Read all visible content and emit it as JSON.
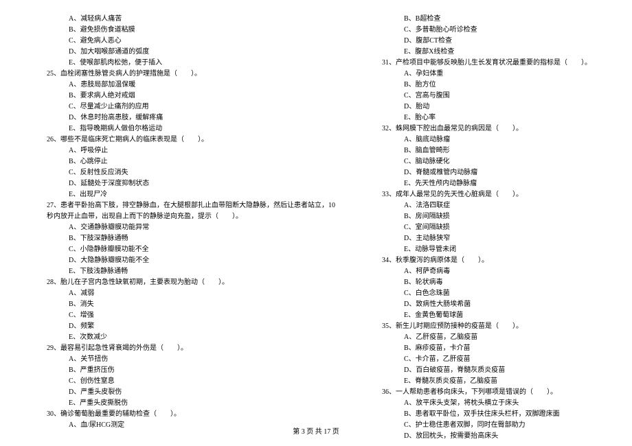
{
  "left_column": {
    "pre_options": [
      "A、减轻病人痛苦",
      "B、避免损伤食道粘膜",
      "C、避免病人恶心",
      "D、加大咽喉部通道的弧度",
      "E、使喉部肌肉松弛，便于插入"
    ],
    "q25": {
      "text": "25、血栓闭塞性脉管炎病人的护理措施是（　　）。",
      "options": [
        "A、患肢局部加温保暖",
        "B、要求病人绝对戒烟",
        "C、尽量减少止痛剂的应用",
        "D、休息时抬高患肢，缓解疼痛",
        "E、指导晚期病人做伯尔格运动"
      ]
    },
    "q26": {
      "text": "26、哪些不是临床死亡期病人的临床表现是（　　）。",
      "options": [
        "A、呼吸停止",
        "B、心跳停止",
        "C、反射性反应消失",
        "D、延髓处于深度抑制状态",
        "E、出现尸冷"
      ]
    },
    "q27": {
      "text": "27、患者平卧抬高下肢，排空静脉血，在大腿根部扎止血带阻断大隐静脉，然后让患者站立，10",
      "continuation": "秒内放开止血带，出现自上而下的静脉逆向充盈，提示（　　）。",
      "options": [
        "A、交通静脉瓣膜功能异常",
        "B、下肢深静脉通畅",
        "C、小隐静脉瓣膜功能不全",
        "D、大隐静脉瓣膜功能不全",
        "E、下肢浅静脉通畅"
      ]
    },
    "q28": {
      "text": "28、胎儿在子宫内急性缺氧初期，主要表现为胎动（　　）。",
      "options": [
        "A、减弱",
        "B、消失",
        "C、增强",
        "D、频繁",
        "E、次数减少"
      ]
    },
    "q29": {
      "text": "29、最容易引起急性肾衰竭的外伤是（　　）。",
      "options": [
        "A、关节扭伤",
        "B、严重挤压伤",
        "C、创伤性窒息",
        "D、严重头皮裂伤",
        "E、严重头皮撕脱伤"
      ]
    },
    "q30": {
      "text": "30、确诊葡萄胎最重要的辅助检查（　　）。",
      "options": [
        "A、血/尿HCG测定"
      ]
    }
  },
  "right_column": {
    "pre_options": [
      "B、B超检查",
      "C、多普勒胎心听诊检查",
      "D、腹部CT检查",
      "E、腹部X线检查"
    ],
    "q31": {
      "text": "31、产检项目中能够反映胎儿生长发育状况最重要的指标是（　　）。",
      "options": [
        "A、孕妇体重",
        "B、胎方位",
        "C、宫高与腹围",
        "D、胎动",
        "E、胎心率"
      ]
    },
    "q32": {
      "text": "32、蛛网膜下腔出血最常见的病因是（　　）。",
      "options": [
        "A、脑底动脉瘤",
        "B、脑血管畸形",
        "C、脑动脉硬化",
        "D、脊髓或椎管内动脉瘤",
        "E、先天性颅内动静脉瘤"
      ]
    },
    "q33": {
      "text": "33、成年人最常见的先天性心脏病是（　　）。",
      "options": [
        "A、法洛四联症",
        "B、房间隔缺损",
        "C、室间隔缺损",
        "D、主动脉狭窄",
        "E、动脉导管未闭"
      ]
    },
    "q34": {
      "text": "34、秋季腹泻的病原体是（　　）。",
      "options": [
        "A、柯萨奇病毒",
        "B、轮状病毒",
        "C、白色念珠菌",
        "D、致病性大肠埃希菌",
        "E、金黄色葡萄球菌"
      ]
    },
    "q35": {
      "text": "35、新生儿时期应预防接种的疫苗是（　　）。",
      "options": [
        "A、乙肝疫苗，乙脑疫苗",
        "B、麻疹疫苗，卡介苗",
        "C、卡介苗，乙肝疫苗",
        "D、百白破疫苗，脊髓灰质炎疫苗",
        "E、脊髓灰质炎疫苗，乙脑疫苗"
      ]
    },
    "q36": {
      "text": "36、一人帮助患者移向床头，下列哪项是错误的（　　）。",
      "options": [
        "A、放平床头支架，将枕头横立于床头",
        "B、患者取平卧位，双手扶住床头栏杆，双脚蹬床面",
        "C、护士稳住患者双脚，同时在臀部助力",
        "D、放回枕头，按需要抬高床头"
      ]
    }
  },
  "footer": "第 3 页 共 17 页"
}
